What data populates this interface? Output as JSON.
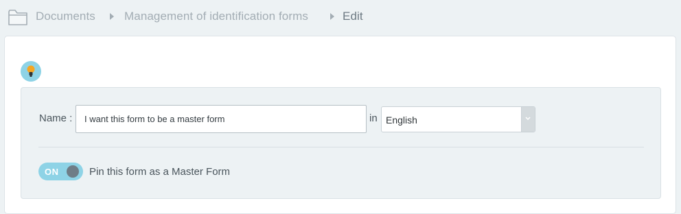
{
  "breadcrumb": {
    "items": [
      {
        "label": "Documents",
        "icon": "folder-icon"
      },
      {
        "label": "Management of identification forms"
      },
      {
        "label": "Edit"
      }
    ]
  },
  "hint": {
    "icon": "lightbulb-icon"
  },
  "form": {
    "name_label": "Name :",
    "name_value": "I want this form to be a master form",
    "in_label": "in",
    "language": {
      "selected": "English"
    },
    "pin_toggle": {
      "state_label": "ON",
      "on": true
    },
    "pin_label": "Pin this form as a Master Form"
  },
  "colors": {
    "background": "#edf2f4",
    "accent": "#8ed3e6",
    "breadcrumb_text": "#a3adb4",
    "breadcrumb_current": "#6d7a83",
    "bulb": "#f5a623"
  }
}
